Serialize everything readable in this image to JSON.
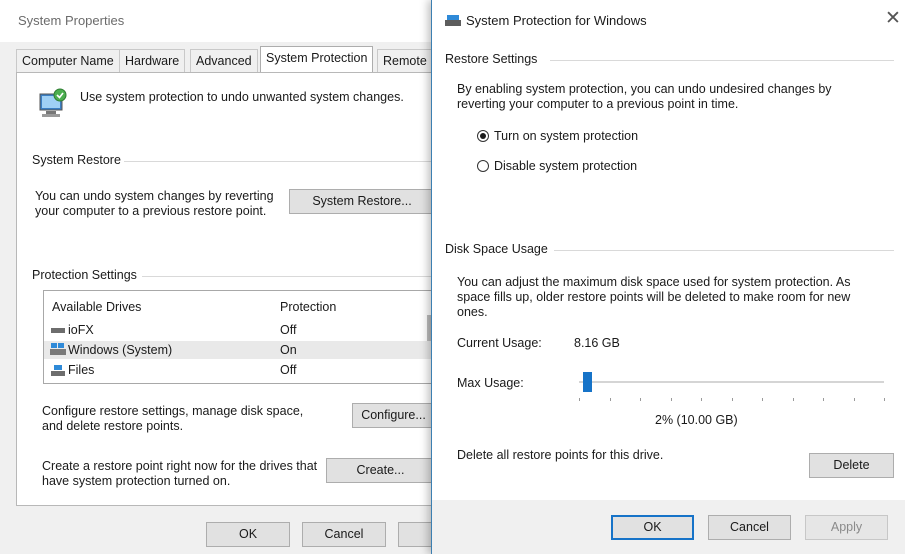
{
  "system_properties": {
    "title": "System Properties",
    "tabs": [
      "Computer Name",
      "Hardware",
      "Advanced",
      "System Protection",
      "Remote"
    ],
    "intro_text": "Use system protection to undo unwanted system changes.",
    "system_restore": {
      "header": "System Restore",
      "text_line1": "You can undo system changes by reverting",
      "text_line2": "your computer to a previous restore point.",
      "button": "System Restore..."
    },
    "protection_settings": {
      "header": "Protection Settings",
      "col_drives": "Available Drives",
      "col_protection": "Protection",
      "drives": [
        {
          "name": "ioFX",
          "protection": "Off"
        },
        {
          "name": "Windows (System)",
          "protection": "On"
        },
        {
          "name": "Files",
          "protection": "Off"
        }
      ]
    },
    "configure_text_line1": "Configure restore settings, manage disk space,",
    "configure_text_line2": "and delete restore points.",
    "configure_button": "Configure...",
    "create_text_line1": "Create a restore point right now for the drives that",
    "create_text_line2": "have system protection turned on.",
    "create_button": "Create...",
    "ok_button": "OK",
    "cancel_button": "Cancel"
  },
  "dialog": {
    "title": "System Protection for Windows",
    "close_glyph": "✕",
    "restore_settings": {
      "header": "Restore Settings",
      "text_line1": "By enabling system protection, you can undo undesired changes by",
      "text_line2": "reverting your computer to a previous point in time.",
      "option_on": "Turn on system protection",
      "option_off": "Disable system protection",
      "selected": "on"
    },
    "disk_space": {
      "header": "Disk Space Usage",
      "text_line1": "You can adjust the maximum disk space used for system protection. As",
      "text_line2": "space fills up, older restore points will be deleted to make room for new",
      "text_line3": "ones.",
      "current_label": "Current Usage:",
      "current_value": "8.16 GB",
      "max_label": "Max Usage:",
      "max_value": "2% (10.00 GB)",
      "max_percent": 2,
      "delete_text": "Delete all restore points for this drive.",
      "delete_button": "Delete"
    },
    "ok_button": "OK",
    "cancel_button": "Cancel",
    "apply_button": "Apply"
  },
  "colors": {
    "accent": "#1673c8",
    "dialog_border": "#3c7fb1",
    "window_bg": "#f0f0f0"
  }
}
